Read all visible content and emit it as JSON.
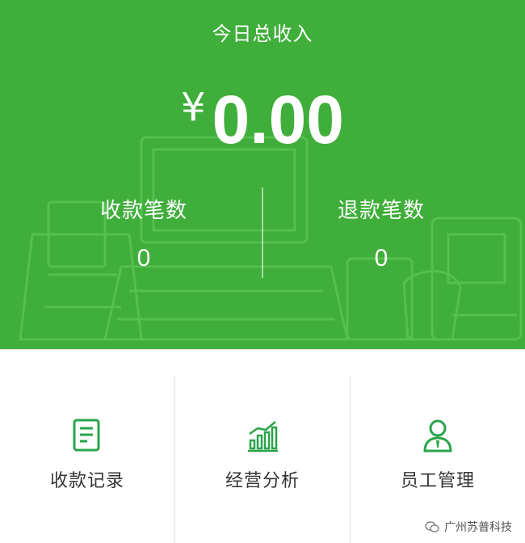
{
  "header": {
    "title": "今日总收入",
    "currency_symbol": "¥",
    "total_amount": "0.00"
  },
  "stats": {
    "payments_label": "收款笔数",
    "payments_count": "0",
    "refunds_label": "退款笔数",
    "refunds_count": "0"
  },
  "menu": {
    "items": [
      {
        "label": "收款记录",
        "icon": "receipt-list-icon"
      },
      {
        "label": "经营分析",
        "icon": "bar-chart-icon"
      },
      {
        "label": "员工管理",
        "icon": "staff-user-icon"
      }
    ]
  },
  "watermark": {
    "text": "广州苏普科技",
    "icon": "wechat-icon"
  },
  "colors": {
    "brand_green": "#3fae3a",
    "icon_green": "#2aa44a",
    "text_dark": "#333333"
  }
}
